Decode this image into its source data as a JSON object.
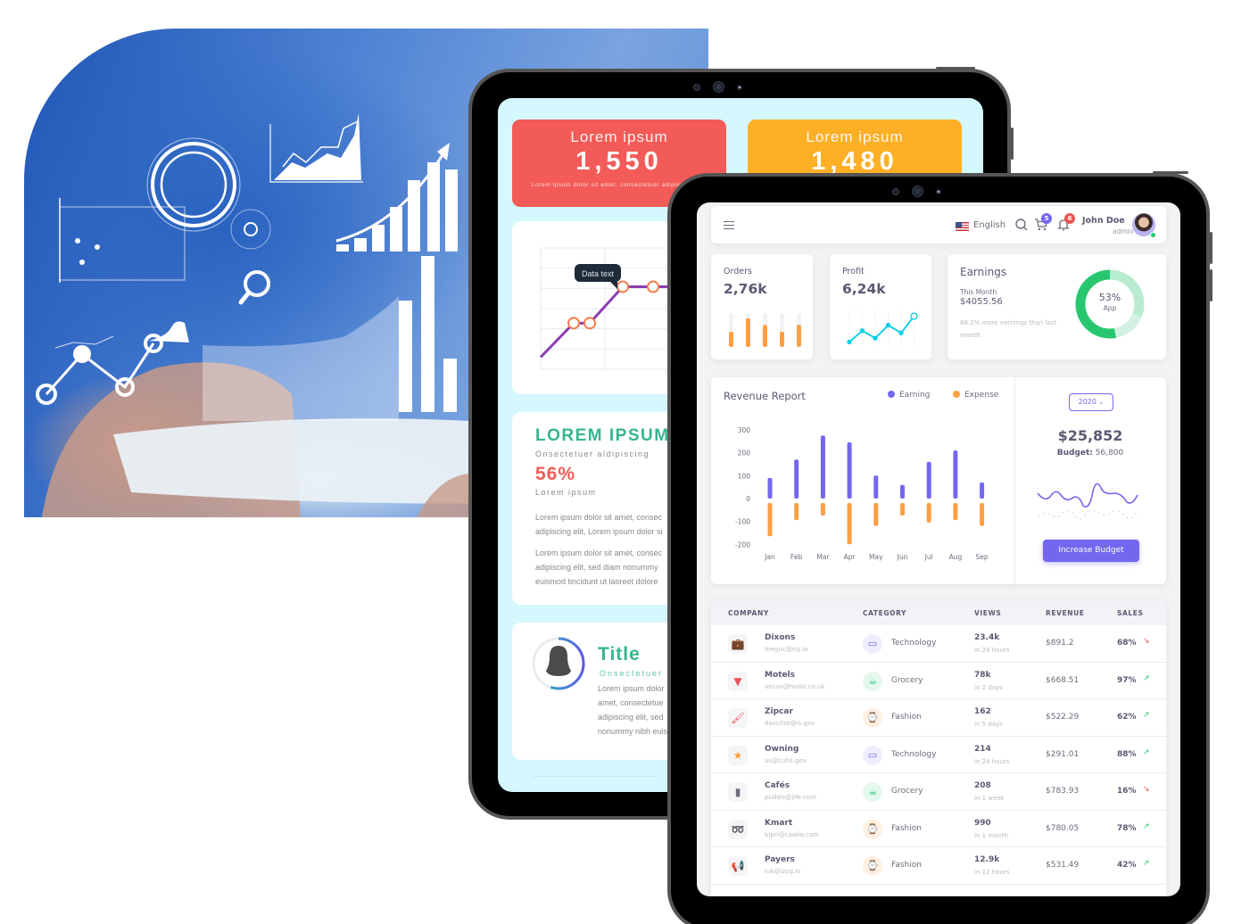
{
  "hero": {
    "image": "person-holding-tablet-with-analytics-overlay",
    "colors": {
      "primary": "#3f78cf"
    }
  },
  "back_tablet": {
    "stat_cards": [
      {
        "label": "Lorem ipsum",
        "value": "1,550",
        "caption": "Lorem ipsum dolor sit amet, consectetuer adipiscing elit,",
        "color": "#f25b57"
      },
      {
        "label": "Lorem ipsum",
        "value": "1,480",
        "caption": "",
        "color": "#fdaf26"
      }
    ],
    "chart_card": {
      "tooltip": "Data text",
      "points": [
        10,
        38,
        38,
        68,
        68,
        68
      ],
      "line_color": "#8b3fb0",
      "marker_color": "#f47c4c"
    },
    "text_card": {
      "title": "LOREM IPSUM",
      "subtitle": "Onsectetuer aldipiscing",
      "percent": "56%",
      "percent_label": "Lorem ipsum",
      "paragraph1": [
        "Lorem ipsum dolor sit amet, consec",
        "adipiscing elit, Lorem ipsum dolor si"
      ],
      "paragraph2": [
        "Lorem ipsum dolor sit amet, consec",
        "adipiscing elit, sed diam nonummy",
        "euismod tincidunt ut laoreet dolore"
      ]
    },
    "profile_card": {
      "title": "Title",
      "subtitle": "Onsectetuer a",
      "paragraph": [
        "Lorem ipsum dolor",
        "amet, consectetue",
        "adipiscing elit, sed",
        "nonummy nibh euis"
      ],
      "progress": 0.55
    }
  },
  "front_tablet": {
    "topbar": {
      "language": "English",
      "cart_count": "5",
      "notification_count": "6",
      "user_name": "John Doe",
      "user_role": "admin",
      "badge_colors": {
        "cart": "#7367f0",
        "notification": "#ea5455"
      }
    },
    "orders": {
      "label": "Orders",
      "value": "2,76k",
      "bars": [
        0.45,
        0.85,
        0.65,
        0.45,
        0.65
      ]
    },
    "profit": {
      "label": "Profit",
      "value": "6,24k",
      "points": [
        10,
        45,
        22,
        62,
        38,
        90
      ]
    },
    "earnings": {
      "title": "Earnings",
      "period": "This Month",
      "amount": "$4055.56",
      "note": "68.2% more earnings than last month.",
      "donut_percent": "53%",
      "donut_label": "App",
      "donut_slices": [
        53,
        16,
        31
      ]
    },
    "revenue": {
      "title": "Revenue Report",
      "legend": [
        {
          "label": "Earning",
          "color": "#7367f0"
        },
        {
          "label": "Expense",
          "color": "#ff9f43"
        }
      ],
      "year": "2020",
      "total": "$25,852",
      "budget_label": "Budget:",
      "budget_value": "56,800",
      "button": "Increase Budget"
    },
    "chart_data": {
      "type": "bar",
      "title": "Revenue Report",
      "categories": [
        "Jan",
        "Feb",
        "Mar",
        "Apr",
        "May",
        "Jun",
        "Jul",
        "Aug",
        "Sep"
      ],
      "series": [
        {
          "name": "Earning",
          "values": [
            90,
            170,
            275,
            245,
            100,
            60,
            160,
            210,
            70
          ]
        },
        {
          "name": "Expense",
          "values": [
            -165,
            -95,
            -75,
            -200,
            -120,
            -75,
            -105,
            -95,
            -120
          ]
        }
      ],
      "yticks": [
        "300",
        "200",
        "100",
        "0",
        "-100",
        "-200"
      ],
      "ylim": [
        -200,
        300
      ],
      "xlabel": "",
      "ylabel": "",
      "grid": false,
      "legend": "top-right"
    },
    "table": {
      "headers": [
        "COMPANY",
        "CATEGORY",
        "VIEWS",
        "REVENUE",
        "SALES"
      ],
      "rows": [
        {
          "company": "Dixons",
          "email": "meguc@ruj.io",
          "logo": "briefcase-icon",
          "category": "Technology",
          "views": "23.4k",
          "period": "in 24 hours",
          "revenue": "$891.2",
          "sales": "68%",
          "trend": "down"
        },
        {
          "company": "Motels",
          "email": "vecav@hodzi.co.uk",
          "logo": "fox-icon",
          "category": "Grocery",
          "views": "78k",
          "period": "in 2 days",
          "revenue": "$668.51",
          "sales": "97%",
          "trend": "up"
        },
        {
          "company": "Zipcar",
          "email": "davcilse@is.gov",
          "logo": "paint-roller-icon",
          "category": "Fashion",
          "views": "162",
          "period": "in 5 days",
          "revenue": "$522.29",
          "sales": "62%",
          "trend": "up"
        },
        {
          "company": "Owning",
          "email": "us@cuhil.gov",
          "logo": "star-icon",
          "category": "Technology",
          "views": "214",
          "period": "in 24 hours",
          "revenue": "$291.01",
          "sales": "88%",
          "trend": "up"
        },
        {
          "company": "Cafés",
          "email": "pudais@jife.com",
          "logo": "notebook-icon",
          "category": "Grocery",
          "views": "208",
          "period": "in 1 week",
          "revenue": "$783.93",
          "sales": "16%",
          "trend": "down"
        },
        {
          "company": "Kmart",
          "email": "bipri@cawiw.com",
          "logo": "rocket-icon",
          "category": "Fashion",
          "views": "990",
          "period": "in 1 month",
          "revenue": "$780.05",
          "sales": "78%",
          "trend": "up"
        },
        {
          "company": "Payers",
          "email": "luk@izug.io",
          "logo": "megaphone-icon",
          "category": "Fashion",
          "views": "12.9k",
          "period": "in 12 hours",
          "revenue": "$531.49",
          "sales": "42%",
          "trend": "up"
        }
      ]
    }
  }
}
